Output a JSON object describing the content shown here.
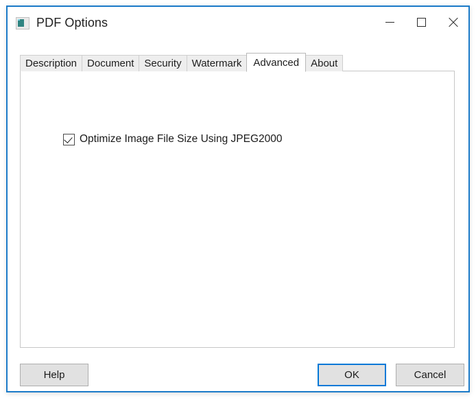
{
  "window": {
    "title": "PDF Options",
    "icon": "pdf-options-app-icon",
    "controls": {
      "minimize": "minimize-icon",
      "maximize": "maximize-icon",
      "close": "close-icon"
    },
    "border_color": "#1a7ac8"
  },
  "tabs": [
    {
      "label": "Description",
      "active": false
    },
    {
      "label": "Document",
      "active": false
    },
    {
      "label": "Security",
      "active": false
    },
    {
      "label": "Watermark",
      "active": false
    },
    {
      "label": "Advanced",
      "active": true
    },
    {
      "label": "About",
      "active": false
    }
  ],
  "active_tab": "Advanced",
  "panel": {
    "options": [
      {
        "label": "Optimize Image File Size Using JPEG2000",
        "checked": true
      }
    ]
  },
  "footer": {
    "help_label": "Help",
    "ok_label": "OK",
    "cancel_label": "Cancel",
    "focus_color": "#0078d7"
  }
}
